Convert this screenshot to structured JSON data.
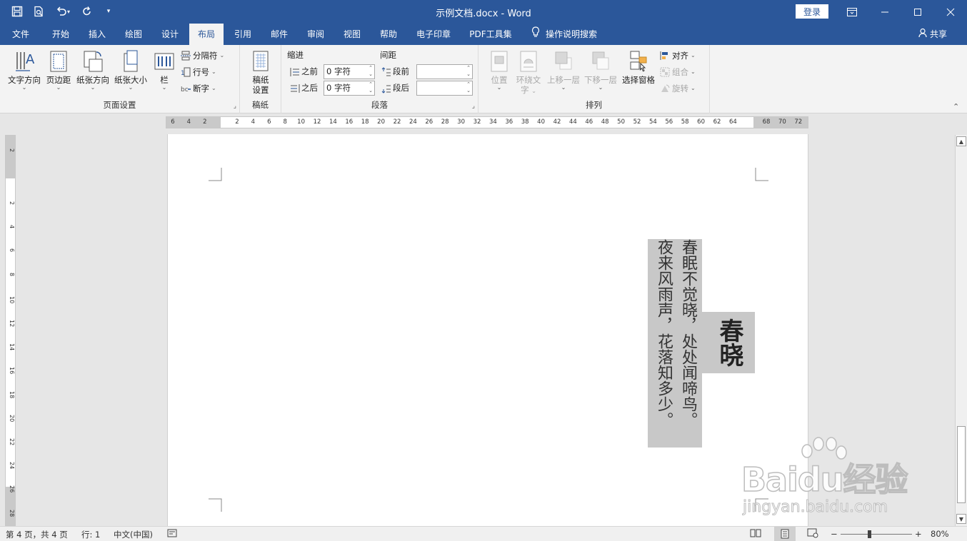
{
  "window": {
    "title": "示例文档.docx  -  Word",
    "login_label": "登录",
    "colors": {
      "titlebar": "#2b579a",
      "ribbon": "#f3f3f3"
    }
  },
  "qat": {
    "items": [
      "save-icon",
      "print-preview-icon",
      "undo-icon",
      "redo-icon",
      "customize-icon"
    ]
  },
  "tabs": [
    "文件",
    "开始",
    "插入",
    "绘图",
    "设计",
    "布局",
    "引用",
    "邮件",
    "审阅",
    "视图",
    "帮助",
    "电子印章",
    "PDF工具集"
  ],
  "active_tab": "布局",
  "tell_me": "操作说明搜索",
  "share": "共享",
  "ribbon": {
    "page_setup": {
      "label": "页面设置",
      "text_direction": "文字方向",
      "margins": "页边距",
      "orientation": "纸张方向",
      "size": "纸张大小",
      "columns": "栏",
      "breaks": "分隔符",
      "line_numbers": "行号",
      "hyphenation": "断字"
    },
    "manuscript": {
      "label": "稿纸",
      "btn_line1": "稿纸",
      "btn_line2": "设置"
    },
    "paragraph": {
      "label": "段落",
      "indent_title": "缩进",
      "spacing_title": "间距",
      "before_label": "之前",
      "after_label": "之后",
      "before_value": "0 字符",
      "after_value": "0 字符",
      "space_before_label": "段前",
      "space_after_label": "段后",
      "space_before_value": "",
      "space_after_value": ""
    },
    "arrange": {
      "label": "排列",
      "position": "位置",
      "wrap_line1": "环绕文",
      "wrap_line2": "字",
      "bring_forward": "上移一层",
      "send_backward": "下移一层",
      "selection_pane": "选择窗格",
      "align": "对齐",
      "group": "组合",
      "rotate": "旋转"
    }
  },
  "ruler": {
    "h_left": [
      "6",
      "4",
      "2"
    ],
    "h_main": [
      "2",
      "4",
      "6",
      "8",
      "10",
      "12",
      "14",
      "16",
      "18",
      "20",
      "22",
      "24",
      "26",
      "28",
      "30",
      "32",
      "34",
      "36",
      "38",
      "40",
      "42",
      "44",
      "46",
      "48",
      "50",
      "52",
      "54",
      "56",
      "58",
      "60",
      "62",
      "64"
    ],
    "h_right": [
      "68",
      "70",
      "72"
    ],
    "v_top": [
      "2"
    ],
    "v_main": [
      "2",
      "4",
      "6",
      "8",
      "10",
      "12",
      "14",
      "16",
      "18",
      "20",
      "22",
      "24",
      "26",
      "28"
    ]
  },
  "document": {
    "poem_line1": "春眠不觉晓，处处闻啼鸟。",
    "poem_line2": "夜来风雨声，花落知多少。",
    "poem_title": "春晓"
  },
  "watermark": {
    "brand": "Baidu经验",
    "url": "jingyan.baidu.com"
  },
  "status": {
    "page": "第 4 页，共 4 页",
    "line": "行: 1",
    "language": "中文(中国)",
    "zoom": "80%",
    "zoom_fraction": 0.5
  }
}
